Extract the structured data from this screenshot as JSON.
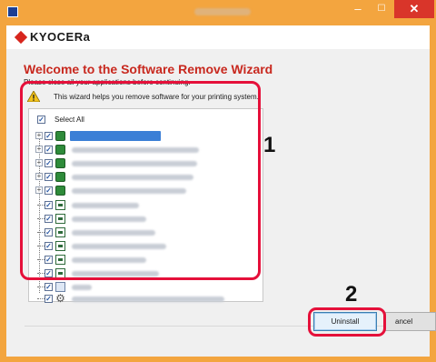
{
  "window": {
    "close_glyph": "✕",
    "max_glyph": "☐",
    "min_glyph": "–"
  },
  "brand": {
    "logo_text": "KYOCERa",
    "logo_color": "#d7251d"
  },
  "wizard": {
    "heading": "Welcome to the Software Remove Wizard",
    "instruction": "Please close all your applications before continuing.",
    "help_text": "This wizard helps you remove software for your printing system."
  },
  "tree": {
    "select_all_label": "Select All",
    "items": [
      {
        "icon": "printer-driver-icon",
        "expandable": true,
        "selected": true
      },
      {
        "icon": "printer-driver-icon",
        "expandable": true,
        "selected": false
      },
      {
        "icon": "printer-driver-icon",
        "expandable": true,
        "selected": false
      },
      {
        "icon": "printer-driver-icon",
        "expandable": true,
        "selected": false
      },
      {
        "icon": "printer-driver-icon",
        "expandable": true,
        "selected": false
      },
      {
        "icon": "utility-icon",
        "expandable": false,
        "selected": false
      },
      {
        "icon": "utility-icon",
        "expandable": false,
        "selected": false
      },
      {
        "icon": "utility-icon",
        "expandable": false,
        "selected": false
      },
      {
        "icon": "utility-icon",
        "expandable": false,
        "selected": false
      },
      {
        "icon": "utility-icon",
        "expandable": false,
        "selected": false
      },
      {
        "icon": "utility-icon",
        "expandable": false,
        "selected": false
      },
      {
        "icon": "font-icon",
        "expandable": false,
        "selected": false
      },
      {
        "icon": "gear-icon",
        "expandable": false,
        "selected": false
      }
    ]
  },
  "annotations": {
    "step1": "1",
    "step2": "2",
    "highlight_color": "#e5103a"
  },
  "buttons": {
    "uninstall": "Uninstall",
    "cancel": "ancel"
  },
  "colors": {
    "title_bar": "#f3a53f",
    "heading": "#c8281e",
    "selection": "#3b7fd6"
  }
}
